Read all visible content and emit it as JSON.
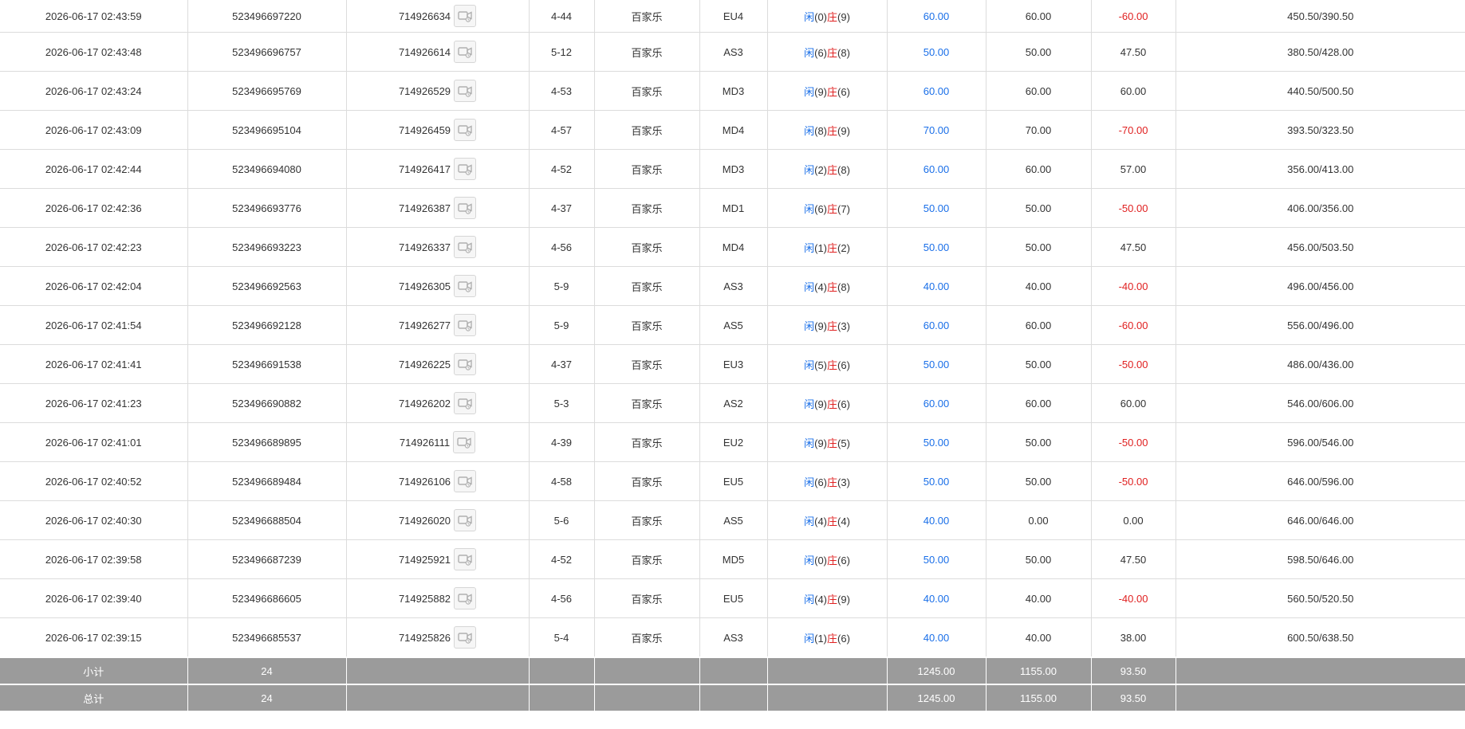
{
  "colors": {
    "player_blue": "#1a6fe8",
    "banker_red": "#e02020",
    "summary_bg": "#9b9b9b"
  },
  "icons": {
    "video_replay": "video-replay-icon"
  },
  "rows": [
    {
      "time": "2026-06-17 02:43:59",
      "order_id": "523496697220",
      "round_id": "714926634",
      "shoe": "4-44",
      "game": "百家乐",
      "table": "EU4",
      "player_label": "闲",
      "player_score": "(0)",
      "banker_label": "庄",
      "banker_score": "(9)",
      "bet": "60.00",
      "valid_bet": "60.00",
      "win_loss": "-60.00",
      "win_loss_neg": true,
      "balance": "450.50/390.50"
    },
    {
      "time": "2026-06-17 02:43:48",
      "order_id": "523496696757",
      "round_id": "714926614",
      "shoe": "5-12",
      "game": "百家乐",
      "table": "AS3",
      "player_label": "闲",
      "player_score": "(6)",
      "banker_label": "庄",
      "banker_score": "(8)",
      "bet": "50.00",
      "valid_bet": "50.00",
      "win_loss": "47.50",
      "win_loss_neg": false,
      "balance": "380.50/428.00"
    },
    {
      "time": "2026-06-17 02:43:24",
      "order_id": "523496695769",
      "round_id": "714926529",
      "shoe": "4-53",
      "game": "百家乐",
      "table": "MD3",
      "player_label": "闲",
      "player_score": "(9)",
      "banker_label": "庄",
      "banker_score": "(6)",
      "bet": "60.00",
      "valid_bet": "60.00",
      "win_loss": "60.00",
      "win_loss_neg": false,
      "balance": "440.50/500.50"
    },
    {
      "time": "2026-06-17 02:43:09",
      "order_id": "523496695104",
      "round_id": "714926459",
      "shoe": "4-57",
      "game": "百家乐",
      "table": "MD4",
      "player_label": "闲",
      "player_score": "(8)",
      "banker_label": "庄",
      "banker_score": "(9)",
      "bet": "70.00",
      "valid_bet": "70.00",
      "win_loss": "-70.00",
      "win_loss_neg": true,
      "balance": "393.50/323.50"
    },
    {
      "time": "2026-06-17 02:42:44",
      "order_id": "523496694080",
      "round_id": "714926417",
      "shoe": "4-52",
      "game": "百家乐",
      "table": "MD3",
      "player_label": "闲",
      "player_score": "(2)",
      "banker_label": "庄",
      "banker_score": "(8)",
      "bet": "60.00",
      "valid_bet": "60.00",
      "win_loss": "57.00",
      "win_loss_neg": false,
      "balance": "356.00/413.00"
    },
    {
      "time": "2026-06-17 02:42:36",
      "order_id": "523496693776",
      "round_id": "714926387",
      "shoe": "4-37",
      "game": "百家乐",
      "table": "MD1",
      "player_label": "闲",
      "player_score": "(6)",
      "banker_label": "庄",
      "banker_score": "(7)",
      "bet": "50.00",
      "valid_bet": "50.00",
      "win_loss": "-50.00",
      "win_loss_neg": true,
      "balance": "406.00/356.00"
    },
    {
      "time": "2026-06-17 02:42:23",
      "order_id": "523496693223",
      "round_id": "714926337",
      "shoe": "4-56",
      "game": "百家乐",
      "table": "MD4",
      "player_label": "闲",
      "player_score": "(1)",
      "banker_label": "庄",
      "banker_score": "(2)",
      "bet": "50.00",
      "valid_bet": "50.00",
      "win_loss": "47.50",
      "win_loss_neg": false,
      "balance": "456.00/503.50"
    },
    {
      "time": "2026-06-17 02:42:04",
      "order_id": "523496692563",
      "round_id": "714926305",
      "shoe": "5-9",
      "game": "百家乐",
      "table": "AS3",
      "player_label": "闲",
      "player_score": "(4)",
      "banker_label": "庄",
      "banker_score": "(8)",
      "bet": "40.00",
      "valid_bet": "40.00",
      "win_loss": "-40.00",
      "win_loss_neg": true,
      "balance": "496.00/456.00"
    },
    {
      "time": "2026-06-17 02:41:54",
      "order_id": "523496692128",
      "round_id": "714926277",
      "shoe": "5-9",
      "game": "百家乐",
      "table": "AS5",
      "player_label": "闲",
      "player_score": "(9)",
      "banker_label": "庄",
      "banker_score": "(3)",
      "bet": "60.00",
      "valid_bet": "60.00",
      "win_loss": "-60.00",
      "win_loss_neg": true,
      "balance": "556.00/496.00"
    },
    {
      "time": "2026-06-17 02:41:41",
      "order_id": "523496691538",
      "round_id": "714926225",
      "shoe": "4-37",
      "game": "百家乐",
      "table": "EU3",
      "player_label": "闲",
      "player_score": "(5)",
      "banker_label": "庄",
      "banker_score": "(6)",
      "bet": "50.00",
      "valid_bet": "50.00",
      "win_loss": "-50.00",
      "win_loss_neg": true,
      "balance": "486.00/436.00"
    },
    {
      "time": "2026-06-17 02:41:23",
      "order_id": "523496690882",
      "round_id": "714926202",
      "shoe": "5-3",
      "game": "百家乐",
      "table": "AS2",
      "player_label": "闲",
      "player_score": "(9)",
      "banker_label": "庄",
      "banker_score": "(6)",
      "bet": "60.00",
      "valid_bet": "60.00",
      "win_loss": "60.00",
      "win_loss_neg": false,
      "balance": "546.00/606.00"
    },
    {
      "time": "2026-06-17 02:41:01",
      "order_id": "523496689895",
      "round_id": "714926111",
      "shoe": "4-39",
      "game": "百家乐",
      "table": "EU2",
      "player_label": "闲",
      "player_score": "(9)",
      "banker_label": "庄",
      "banker_score": "(5)",
      "bet": "50.00",
      "valid_bet": "50.00",
      "win_loss": "-50.00",
      "win_loss_neg": true,
      "balance": "596.00/546.00"
    },
    {
      "time": "2026-06-17 02:40:52",
      "order_id": "523496689484",
      "round_id": "714926106",
      "shoe": "4-58",
      "game": "百家乐",
      "table": "EU5",
      "player_label": "闲",
      "player_score": "(6)",
      "banker_label": "庄",
      "banker_score": "(3)",
      "bet": "50.00",
      "valid_bet": "50.00",
      "win_loss": "-50.00",
      "win_loss_neg": true,
      "balance": "646.00/596.00"
    },
    {
      "time": "2026-06-17 02:40:30",
      "order_id": "523496688504",
      "round_id": "714926020",
      "shoe": "5-6",
      "game": "百家乐",
      "table": "AS5",
      "player_label": "闲",
      "player_score": "(4)",
      "banker_label": "庄",
      "banker_score": "(4)",
      "bet": "40.00",
      "valid_bet": "0.00",
      "win_loss": "0.00",
      "win_loss_neg": false,
      "balance": "646.00/646.00"
    },
    {
      "time": "2026-06-17 02:39:58",
      "order_id": "523496687239",
      "round_id": "714925921",
      "shoe": "4-52",
      "game": "百家乐",
      "table": "MD5",
      "player_label": "闲",
      "player_score": "(0)",
      "banker_label": "庄",
      "banker_score": "(6)",
      "bet": "50.00",
      "valid_bet": "50.00",
      "win_loss": "47.50",
      "win_loss_neg": false,
      "balance": "598.50/646.00"
    },
    {
      "time": "2026-06-17 02:39:40",
      "order_id": "523496686605",
      "round_id": "714925882",
      "shoe": "4-56",
      "game": "百家乐",
      "table": "EU5",
      "player_label": "闲",
      "player_score": "(4)",
      "banker_label": "庄",
      "banker_score": "(9)",
      "bet": "40.00",
      "valid_bet": "40.00",
      "win_loss": "-40.00",
      "win_loss_neg": true,
      "balance": "560.50/520.50"
    },
    {
      "time": "2026-06-17 02:39:15",
      "order_id": "523496685537",
      "round_id": "714925826",
      "shoe": "5-4",
      "game": "百家乐",
      "table": "AS3",
      "player_label": "闲",
      "player_score": "(1)",
      "banker_label": "庄",
      "banker_score": "(6)",
      "bet": "40.00",
      "valid_bet": "40.00",
      "win_loss": "38.00",
      "win_loss_neg": false,
      "balance": "600.50/638.50"
    }
  ],
  "subtotal": {
    "label": "小计",
    "count": "24",
    "bet": "1245.00",
    "valid_bet": "1155.00",
    "win_loss": "93.50"
  },
  "total": {
    "label": "总计",
    "count": "24",
    "bet": "1245.00",
    "valid_bet": "1155.00",
    "win_loss": "93.50"
  }
}
